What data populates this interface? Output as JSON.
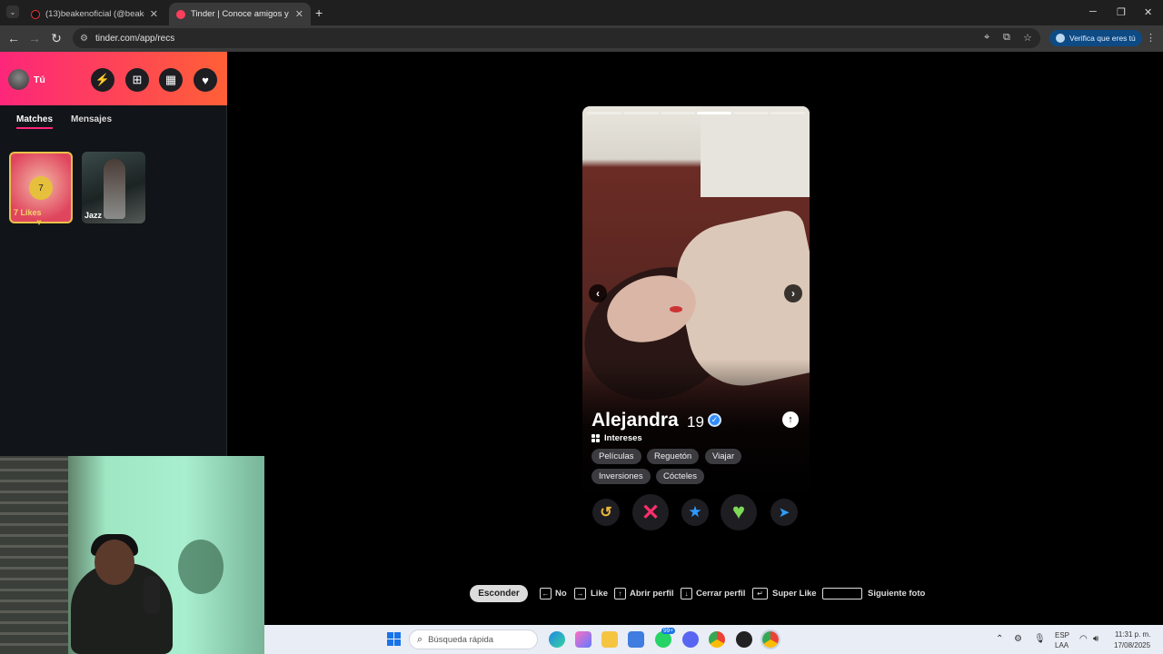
{
  "browser": {
    "tabs": [
      {
        "title": "(13)beakenoficial (@beakenofi",
        "active": false
      },
      {
        "title": "Tinder | Conoce amigos y gente",
        "active": true
      }
    ],
    "new_tab": "+",
    "url": "tinder.com/app/recs",
    "verify_label": "Verifica que eres tú",
    "window": {
      "minimize": "─",
      "maximize": "❐",
      "close": "✕"
    }
  },
  "sidebar": {
    "user_label": "Tú",
    "tabs": {
      "matches": "Matches",
      "messages": "Mensajes"
    },
    "likes_card": {
      "count": "7",
      "label": "7 Likes"
    },
    "match_card": {
      "label": "Jazz"
    }
  },
  "profile": {
    "name": "Alejandra",
    "age": "19",
    "verified": true,
    "interests_title": "Intereses",
    "interests": [
      "Películas",
      "Reguetón",
      "Viajar",
      "Inversiones",
      "Cócteles"
    ],
    "photo_count": 6,
    "current_photo": 4
  },
  "actions": {
    "rewind": "rewind-icon",
    "nope": "close-icon",
    "super_like": "star-icon",
    "like": "heart-icon",
    "boost": "send-icon"
  },
  "shortcuts": {
    "hide": "Esconder",
    "no": "No",
    "like": "Like",
    "open_profile": "Abrir perfil",
    "close_profile": "Cerrar perfil",
    "super_like": "Super Like",
    "next_photo": "Siguiente foto"
  },
  "taskbar": {
    "search_placeholder": "Búsqueda rápida",
    "lang_top": "ESP",
    "lang_bottom": "LAA",
    "time": "11:31 p. m.",
    "date": "17/08/2025",
    "badge": "99+"
  },
  "colors": {
    "brand_start": "#fd267a",
    "brand_end": "#ff6036",
    "like_green": "#7ed957",
    "nope_pink": "#ff2f6c",
    "super_blue": "#2e9cff",
    "rewind_gold": "#f0b93a"
  }
}
